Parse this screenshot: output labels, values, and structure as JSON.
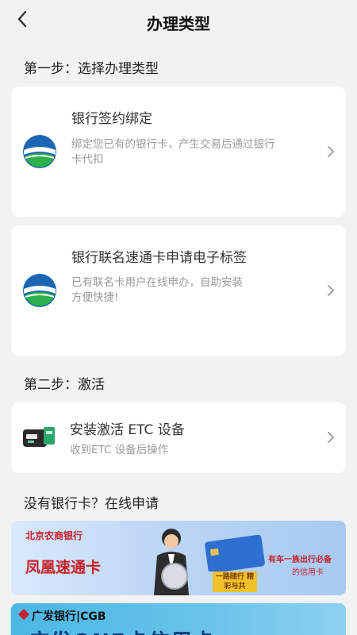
{
  "header": {
    "title": "办理类型",
    "back_icon": "chevron-left-icon"
  },
  "step1": {
    "label": "第一步：选择办理类型"
  },
  "cards": [
    {
      "title": "银行签约绑定",
      "desc_line1": "绑定您已有的银行卡，产生交易后通过银行",
      "desc_line2": "卡代扣",
      "icon": "bank-logo-icon"
    },
    {
      "title": "银行联名速通卡申请电子标签",
      "desc_line1": "已有联名卡用户在线申办，自助安装",
      "desc_line2": "方便快捷!",
      "icon": "bank-logo-icon"
    }
  ],
  "step2": {
    "label": "第二步：激活"
  },
  "activate": {
    "title": "安装激活 ETC 设备",
    "desc": "收到ETC 设备后操作",
    "icon": "etc-device-icon"
  },
  "step3": {
    "label": "没有银行卡？在线申请"
  },
  "banners": {
    "b1": {
      "brand": "北京农商银行",
      "product": "凤凰速通卡",
      "slogan1": "有车一族出行必备",
      "slogan2": "的信用卡",
      "chip": "一路随行 精彩与共"
    },
    "b2": {
      "brand": "广发银行|CGB",
      "headline": "广发ONE卡信用卡"
    }
  },
  "colors": {
    "background": "#f2f2f2",
    "card": "#ffffff",
    "logo_blue": "#1a66b3",
    "logo_green": "#2bb04a",
    "brand_red": "#c8212a"
  }
}
